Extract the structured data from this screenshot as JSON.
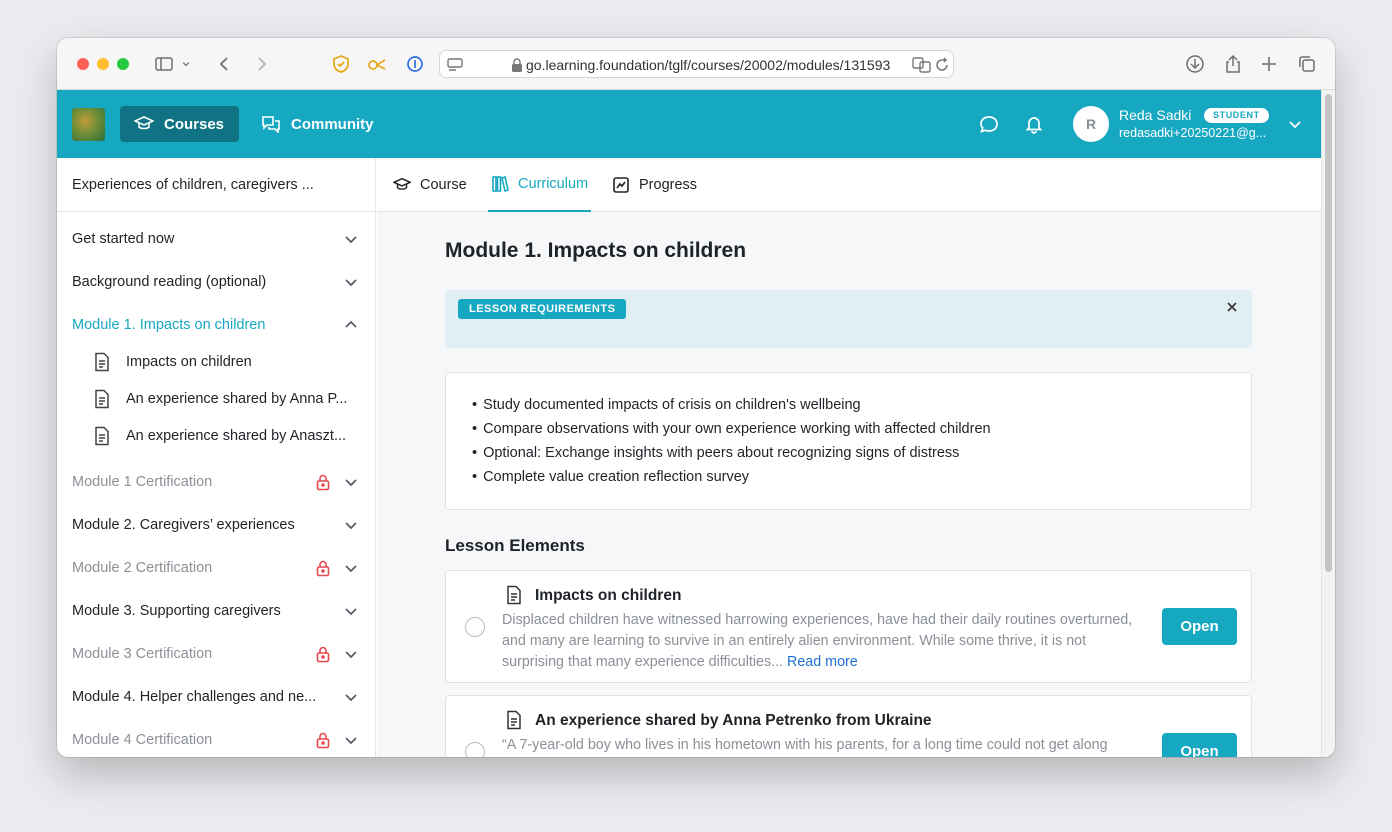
{
  "browser": {
    "url": "go.learning.foundation/tglf/courses/20002/modules/131593"
  },
  "header": {
    "nav": [
      {
        "label": "Courses",
        "icon": "graduation-cap-icon"
      },
      {
        "label": "Community",
        "icon": "chat-bubbles-icon"
      }
    ],
    "user": {
      "initial": "R",
      "name": "Reda Sadki",
      "role": "STUDENT",
      "email": "redasadki+20250221@g..."
    },
    "colors": {
      "brand": "#17a8c1",
      "active_nav": "#0f7383"
    }
  },
  "sidebar": {
    "course_title": "Experiences of children, caregivers ...",
    "items": [
      {
        "label": "Get started now",
        "locked": false
      },
      {
        "label": "Background reading (optional)",
        "locked": false
      },
      {
        "label": "Module 1. Impacts on children",
        "locked": false,
        "active": true,
        "children": [
          "Impacts on children",
          "An experience shared by Anna P...",
          "An experience shared by Anaszt..."
        ]
      },
      {
        "label": "Module 1 Certification",
        "locked": true
      },
      {
        "label": "Module 2. Caregivers’ experiences",
        "locked": false
      },
      {
        "label": "Module 2 Certification",
        "locked": true
      },
      {
        "label": "Module 3. Supporting caregivers",
        "locked": false
      },
      {
        "label": "Module 3 Certification",
        "locked": true
      },
      {
        "label": "Module 4. Helper challenges and ne...",
        "locked": false
      },
      {
        "label": "Module 4 Certification",
        "locked": true
      }
    ]
  },
  "tabs": [
    {
      "label": "Course",
      "active": false
    },
    {
      "label": "Curriculum",
      "active": true
    },
    {
      "label": "Progress",
      "active": false
    }
  ],
  "main": {
    "module_title": "Module 1. Impacts on children",
    "requirements_badge": "LESSON REQUIREMENTS",
    "requirements": [
      "Study documented impacts of crisis on children's wellbeing",
      "Compare observations with your own experience working with affected children",
      "Optional: Exchange insights with peers about recognizing signs of distress",
      "Complete value creation reflection survey"
    ],
    "lesson_elements_title": "Lesson Elements",
    "lessons": [
      {
        "title": "Impacts on children",
        "description": "Displaced children have witnessed harrowing experiences, have had their daily routines overturned, and many are learning to survive in an entirely alien environment. While some thrive, it is not surprising that many experience difficulties...",
        "read_more": "Read more",
        "button": "Open"
      },
      {
        "title": "An experience shared by Anna Petrenko from Ukraine",
        "description": "“A 7-year-old boy who lives in his hometown with his parents, for a long time could not get along",
        "button": "Open"
      }
    ]
  }
}
